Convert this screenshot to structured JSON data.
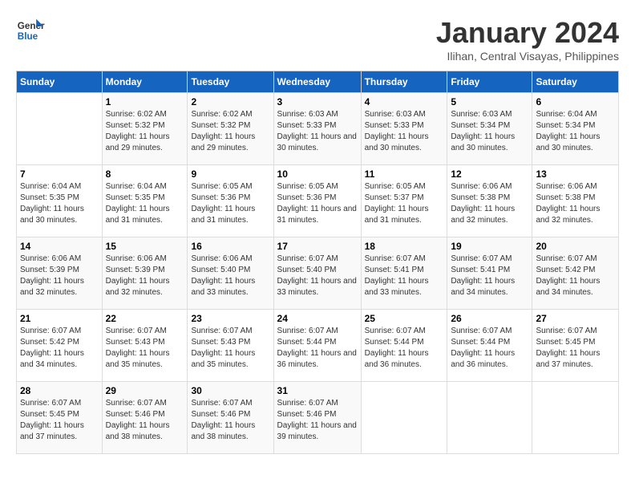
{
  "logo": {
    "line1": "General",
    "line2": "Blue"
  },
  "title": "January 2024",
  "location": "Ilihan, Central Visayas, Philippines",
  "days_of_week": [
    "Sunday",
    "Monday",
    "Tuesday",
    "Wednesday",
    "Thursday",
    "Friday",
    "Saturday"
  ],
  "weeks": [
    [
      {
        "num": "",
        "sunrise": "",
        "sunset": "",
        "daylight": ""
      },
      {
        "num": "1",
        "sunrise": "Sunrise: 6:02 AM",
        "sunset": "Sunset: 5:32 PM",
        "daylight": "Daylight: 11 hours and 29 minutes."
      },
      {
        "num": "2",
        "sunrise": "Sunrise: 6:02 AM",
        "sunset": "Sunset: 5:32 PM",
        "daylight": "Daylight: 11 hours and 29 minutes."
      },
      {
        "num": "3",
        "sunrise": "Sunrise: 6:03 AM",
        "sunset": "Sunset: 5:33 PM",
        "daylight": "Daylight: 11 hours and 30 minutes."
      },
      {
        "num": "4",
        "sunrise": "Sunrise: 6:03 AM",
        "sunset": "Sunset: 5:33 PM",
        "daylight": "Daylight: 11 hours and 30 minutes."
      },
      {
        "num": "5",
        "sunrise": "Sunrise: 6:03 AM",
        "sunset": "Sunset: 5:34 PM",
        "daylight": "Daylight: 11 hours and 30 minutes."
      },
      {
        "num": "6",
        "sunrise": "Sunrise: 6:04 AM",
        "sunset": "Sunset: 5:34 PM",
        "daylight": "Daylight: 11 hours and 30 minutes."
      }
    ],
    [
      {
        "num": "7",
        "sunrise": "Sunrise: 6:04 AM",
        "sunset": "Sunset: 5:35 PM",
        "daylight": "Daylight: 11 hours and 30 minutes."
      },
      {
        "num": "8",
        "sunrise": "Sunrise: 6:04 AM",
        "sunset": "Sunset: 5:35 PM",
        "daylight": "Daylight: 11 hours and 31 minutes."
      },
      {
        "num": "9",
        "sunrise": "Sunrise: 6:05 AM",
        "sunset": "Sunset: 5:36 PM",
        "daylight": "Daylight: 11 hours and 31 minutes."
      },
      {
        "num": "10",
        "sunrise": "Sunrise: 6:05 AM",
        "sunset": "Sunset: 5:36 PM",
        "daylight": "Daylight: 11 hours and 31 minutes."
      },
      {
        "num": "11",
        "sunrise": "Sunrise: 6:05 AM",
        "sunset": "Sunset: 5:37 PM",
        "daylight": "Daylight: 11 hours and 31 minutes."
      },
      {
        "num": "12",
        "sunrise": "Sunrise: 6:06 AM",
        "sunset": "Sunset: 5:38 PM",
        "daylight": "Daylight: 11 hours and 32 minutes."
      },
      {
        "num": "13",
        "sunrise": "Sunrise: 6:06 AM",
        "sunset": "Sunset: 5:38 PM",
        "daylight": "Daylight: 11 hours and 32 minutes."
      }
    ],
    [
      {
        "num": "14",
        "sunrise": "Sunrise: 6:06 AM",
        "sunset": "Sunset: 5:39 PM",
        "daylight": "Daylight: 11 hours and 32 minutes."
      },
      {
        "num": "15",
        "sunrise": "Sunrise: 6:06 AM",
        "sunset": "Sunset: 5:39 PM",
        "daylight": "Daylight: 11 hours and 32 minutes."
      },
      {
        "num": "16",
        "sunrise": "Sunrise: 6:06 AM",
        "sunset": "Sunset: 5:40 PM",
        "daylight": "Daylight: 11 hours and 33 minutes."
      },
      {
        "num": "17",
        "sunrise": "Sunrise: 6:07 AM",
        "sunset": "Sunset: 5:40 PM",
        "daylight": "Daylight: 11 hours and 33 minutes."
      },
      {
        "num": "18",
        "sunrise": "Sunrise: 6:07 AM",
        "sunset": "Sunset: 5:41 PM",
        "daylight": "Daylight: 11 hours and 33 minutes."
      },
      {
        "num": "19",
        "sunrise": "Sunrise: 6:07 AM",
        "sunset": "Sunset: 5:41 PM",
        "daylight": "Daylight: 11 hours and 34 minutes."
      },
      {
        "num": "20",
        "sunrise": "Sunrise: 6:07 AM",
        "sunset": "Sunset: 5:42 PM",
        "daylight": "Daylight: 11 hours and 34 minutes."
      }
    ],
    [
      {
        "num": "21",
        "sunrise": "Sunrise: 6:07 AM",
        "sunset": "Sunset: 5:42 PM",
        "daylight": "Daylight: 11 hours and 34 minutes."
      },
      {
        "num": "22",
        "sunrise": "Sunrise: 6:07 AM",
        "sunset": "Sunset: 5:43 PM",
        "daylight": "Daylight: 11 hours and 35 minutes."
      },
      {
        "num": "23",
        "sunrise": "Sunrise: 6:07 AM",
        "sunset": "Sunset: 5:43 PM",
        "daylight": "Daylight: 11 hours and 35 minutes."
      },
      {
        "num": "24",
        "sunrise": "Sunrise: 6:07 AM",
        "sunset": "Sunset: 5:44 PM",
        "daylight": "Daylight: 11 hours and 36 minutes."
      },
      {
        "num": "25",
        "sunrise": "Sunrise: 6:07 AM",
        "sunset": "Sunset: 5:44 PM",
        "daylight": "Daylight: 11 hours and 36 minutes."
      },
      {
        "num": "26",
        "sunrise": "Sunrise: 6:07 AM",
        "sunset": "Sunset: 5:44 PM",
        "daylight": "Daylight: 11 hours and 36 minutes."
      },
      {
        "num": "27",
        "sunrise": "Sunrise: 6:07 AM",
        "sunset": "Sunset: 5:45 PM",
        "daylight": "Daylight: 11 hours and 37 minutes."
      }
    ],
    [
      {
        "num": "28",
        "sunrise": "Sunrise: 6:07 AM",
        "sunset": "Sunset: 5:45 PM",
        "daylight": "Daylight: 11 hours and 37 minutes."
      },
      {
        "num": "29",
        "sunrise": "Sunrise: 6:07 AM",
        "sunset": "Sunset: 5:46 PM",
        "daylight": "Daylight: 11 hours and 38 minutes."
      },
      {
        "num": "30",
        "sunrise": "Sunrise: 6:07 AM",
        "sunset": "Sunset: 5:46 PM",
        "daylight": "Daylight: 11 hours and 38 minutes."
      },
      {
        "num": "31",
        "sunrise": "Sunrise: 6:07 AM",
        "sunset": "Sunset: 5:46 PM",
        "daylight": "Daylight: 11 hours and 39 minutes."
      },
      {
        "num": "",
        "sunrise": "",
        "sunset": "",
        "daylight": ""
      },
      {
        "num": "",
        "sunrise": "",
        "sunset": "",
        "daylight": ""
      },
      {
        "num": "",
        "sunrise": "",
        "sunset": "",
        "daylight": ""
      }
    ]
  ]
}
